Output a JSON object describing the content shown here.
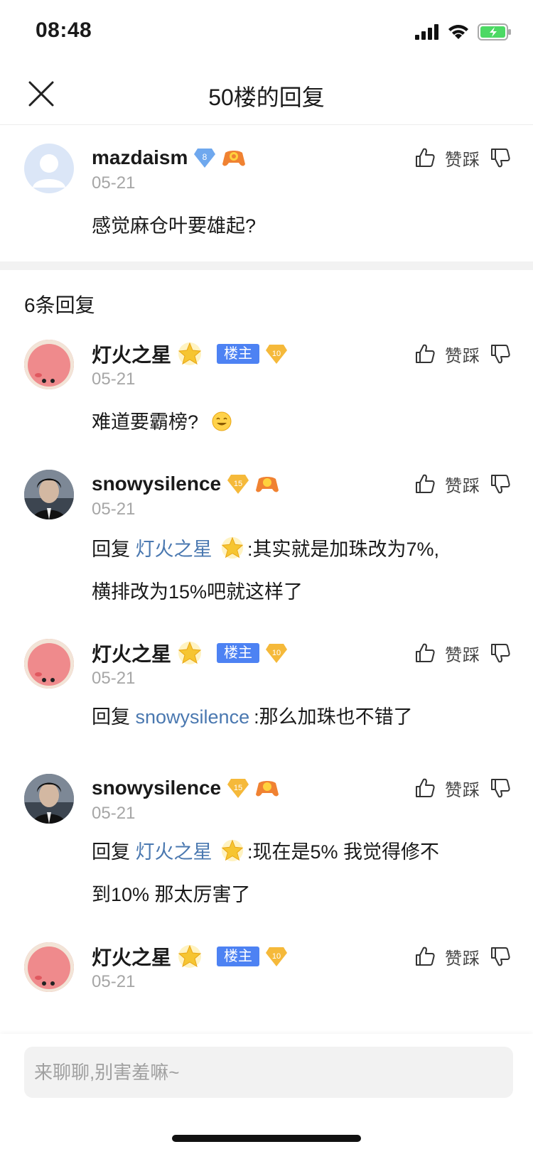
{
  "status_bar": {
    "time": "08:48"
  },
  "header": {
    "title": "50楼的回复"
  },
  "main_post": {
    "username": "mazdaism",
    "level": "8",
    "date": "05-21",
    "content": "感觉麻仓叶要雄起?",
    "like_label": "赞",
    "dislike_label": "踩"
  },
  "reply_count": "6条回复",
  "replies": [
    {
      "username": "灯火之星",
      "owner_tag": "楼主",
      "level": "10",
      "date": "05-21",
      "content": "难道要霸榜?",
      "like_label": "赞",
      "dislike_label": "踩"
    },
    {
      "username": "snowysilence",
      "level": "15",
      "date": "05-21",
      "reply_prefix": "回复 ",
      "reply_to": "灯火之星",
      "content_line1": ":其实就是加珠改为7%,",
      "content_line2": "横排改为15%吧就这样了",
      "like_label": "赞",
      "dislike_label": "踩"
    },
    {
      "username": "灯火之星",
      "owner_tag": "楼主",
      "level": "10",
      "date": "05-21",
      "reply_prefix": "回复 ",
      "reply_to": "snowysilence",
      "content_line1": ":那么加珠也不错了",
      "like_label": "赞",
      "dislike_label": "踩"
    },
    {
      "username": "snowysilence",
      "level": "15",
      "date": "05-21",
      "reply_prefix": "回复 ",
      "reply_to": "灯火之星",
      "content_line1": ":现在是5% 我觉得修不",
      "content_line2": "到10% 那太厉害了",
      "like_label": "赞",
      "dislike_label": "踩"
    },
    {
      "username": "灯火之星",
      "owner_tag": "楼主",
      "level": "10",
      "date": "05-21",
      "like_label": "赞",
      "dislike_label": "踩"
    }
  ],
  "input": {
    "placeholder": "来聊聊,别害羞嘛~"
  },
  "colors": {
    "owner_tag": "#4d82f3",
    "reply_link": "#4a78b0",
    "date": "#a6a6a6",
    "level_gold": "#f5b93a",
    "level_blue": "#6fa8ee"
  }
}
